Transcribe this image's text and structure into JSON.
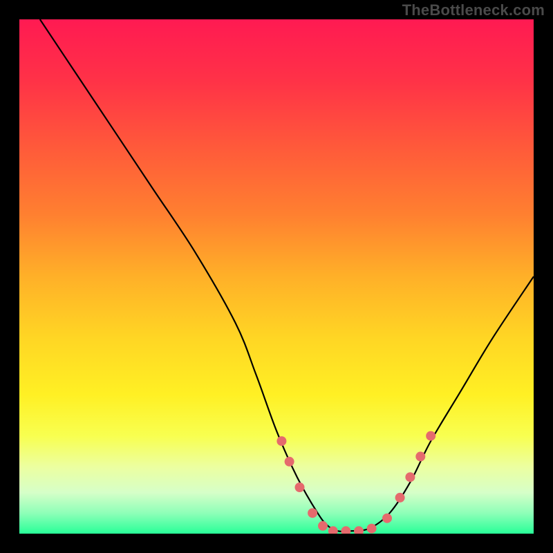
{
  "watermark": "TheBottleneck.com",
  "colors": {
    "background": "#000000",
    "gradient_stops": [
      {
        "offset": 0.0,
        "color": "#ff1a52"
      },
      {
        "offset": 0.12,
        "color": "#ff3247"
      },
      {
        "offset": 0.25,
        "color": "#ff5a3a"
      },
      {
        "offset": 0.38,
        "color": "#ff8030"
      },
      {
        "offset": 0.5,
        "color": "#ffb028"
      },
      {
        "offset": 0.62,
        "color": "#ffd624"
      },
      {
        "offset": 0.73,
        "color": "#fff024"
      },
      {
        "offset": 0.81,
        "color": "#f8ff50"
      },
      {
        "offset": 0.87,
        "color": "#ecffa0"
      },
      {
        "offset": 0.92,
        "color": "#d6ffc8"
      },
      {
        "offset": 0.96,
        "color": "#8effb8"
      },
      {
        "offset": 1.0,
        "color": "#28ff98"
      }
    ],
    "curve": "#000000",
    "dot": "#e56a6d"
  },
  "chart_data": {
    "type": "line",
    "title": "",
    "xlabel": "",
    "ylabel": "",
    "xlim": [
      0,
      100
    ],
    "ylim": [
      0,
      100
    ],
    "grid": false,
    "series": [
      {
        "name": "bottleneck-curve",
        "x": [
          4,
          10,
          18,
          26,
          34,
          42,
          46,
          50,
          54,
          58,
          60,
          62,
          64,
          68,
          72,
          76,
          80,
          86,
          92,
          100
        ],
        "y": [
          100,
          91,
          79,
          67,
          55,
          41,
          31,
          20,
          11,
          4,
          1.5,
          0.5,
          0.5,
          1,
          4,
          10,
          18,
          28,
          38,
          50
        ]
      }
    ],
    "dots": [
      {
        "x": 51.0,
        "y": 18
      },
      {
        "x": 52.5,
        "y": 14
      },
      {
        "x": 54.5,
        "y": 9
      },
      {
        "x": 57.0,
        "y": 4
      },
      {
        "x": 59.0,
        "y": 1.5
      },
      {
        "x": 61.0,
        "y": 0.5
      },
      {
        "x": 63.5,
        "y": 0.5
      },
      {
        "x": 66.0,
        "y": 0.5
      },
      {
        "x": 68.5,
        "y": 1
      },
      {
        "x": 71.5,
        "y": 3
      },
      {
        "x": 74.0,
        "y": 7
      },
      {
        "x": 76.0,
        "y": 11
      },
      {
        "x": 78.0,
        "y": 15
      },
      {
        "x": 80.0,
        "y": 19
      }
    ]
  }
}
